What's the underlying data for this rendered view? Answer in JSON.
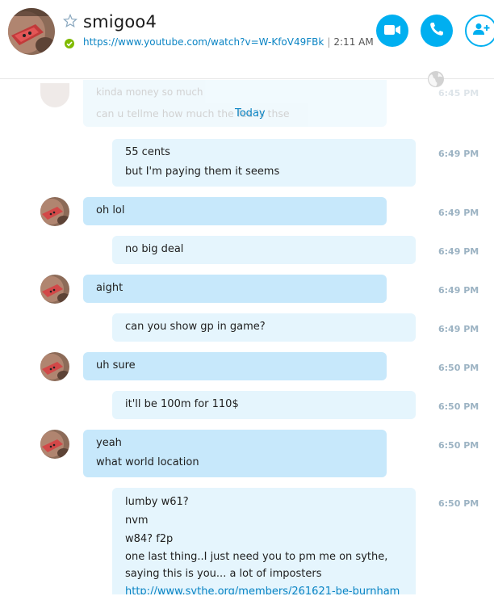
{
  "contact": {
    "name": "smigoo4",
    "mood_link": "https://www.youtube.com/watch?v=W-KfoV49FBk",
    "mood_separator": "|",
    "local_time": "2:11 AM"
  },
  "header_icons": {
    "favorite": "star-outline-icon",
    "status": "online-check-icon",
    "video_call": "video-camera-icon",
    "audio_call": "phone-icon",
    "add_people": "add-person-icon"
  },
  "colors": {
    "accent": "#00aff0",
    "incoming_bubble": "#c7e8fb",
    "outgoing_bubble": "#e5f5fd",
    "link": "#0a84c4"
  },
  "faded_previous": {
    "line1": "kinda money so much",
    "line2": "can u tellme how much the fee is thse",
    "time": "6:45 PM"
  },
  "day_divider": "Today",
  "messages": [
    {
      "dir": "out",
      "time": "6:49 PM",
      "lines": [
        "55 cents",
        "but I'm paying them it seems"
      ]
    },
    {
      "dir": "in",
      "time": "6:49 PM",
      "lines": [
        "oh lol"
      ]
    },
    {
      "dir": "out",
      "time": "6:49 PM",
      "lines": [
        "no big deal"
      ]
    },
    {
      "dir": "in",
      "time": "6:49 PM",
      "lines": [
        "aight"
      ]
    },
    {
      "dir": "out",
      "time": "6:49 PM",
      "lines": [
        "can you show gp in game?"
      ]
    },
    {
      "dir": "in",
      "time": "6:50 PM",
      "lines": [
        "uh sure"
      ]
    },
    {
      "dir": "out",
      "time": "6:50 PM",
      "lines": [
        "it'll be 100m for 110$"
      ]
    },
    {
      "dir": "in",
      "time": "6:50 PM",
      "lines": [
        "yeah",
        "what world location"
      ]
    },
    {
      "dir": "out",
      "time": "6:50 PM",
      "lines": [
        "lumby w61?",
        "nvm",
        "w84? f2p",
        "one last thing..I just need you to pm me on sythe,",
        "saying this is you... a lot of imposters"
      ],
      "link_partial": "http://www.sythe.org/members/261621-be-burnham"
    }
  ]
}
